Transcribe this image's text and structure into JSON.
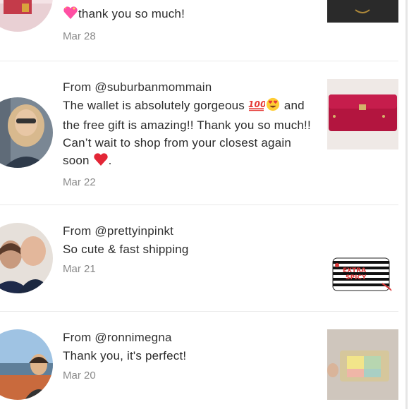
{
  "reviews": [
    {
      "partial_message": "thank you so much!",
      "date": "Mar 28",
      "avatar_icon": "holiday-scene-avatar",
      "thumb_icon": "black-wallet-thumbnail"
    },
    {
      "from": "From @suburbanmommain",
      "message_part1": "The wallet is absolutely gorgeous ",
      "message_part2": " and the free gift is amazing!! Thank you so much!! Can’t wait to shop from your closest again soon ",
      "message_part3": ".",
      "date": "Mar 22",
      "avatar_icon": "woman-selfie-avatar",
      "thumb_icon": "magenta-wallet-thumbnail"
    },
    {
      "from": "From @prettyinpinkt",
      "message": "So cute & fast shipping",
      "date": "Mar 21",
      "avatar_icon": "couple-avatar",
      "thumb_icon": "striped-bag-thumbnail",
      "thumb_label": "EXTRA SPICY"
    },
    {
      "from": "From @ronnimegna",
      "message": "Thank you, it's perfect!",
      "date": "Mar 20",
      "avatar_icon": "beach-selfie-avatar",
      "thumb_icon": "pastel-wallet-thumbnail"
    }
  ]
}
